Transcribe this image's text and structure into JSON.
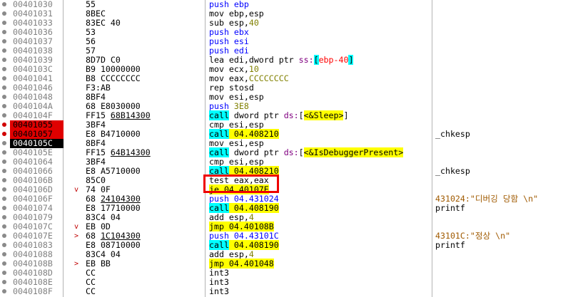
{
  "rows": [
    {
      "addr": "00401030",
      "hex": "55",
      "instr": [
        {
          "t": "push",
          "c": "k-blue"
        },
        {
          "t": " ebp",
          "c": "k-blue"
        }
      ]
    },
    {
      "addr": "00401031",
      "hex": "8BEC",
      "instr": [
        {
          "t": "mov ebp,esp",
          "c": ""
        }
      ]
    },
    {
      "addr": "00401033",
      "hex": "83EC 40",
      "instr": [
        {
          "t": "sub esp,",
          "c": ""
        },
        {
          "t": "40",
          "c": "k-green"
        }
      ]
    },
    {
      "addr": "00401036",
      "hex": "53",
      "instr": [
        {
          "t": "push ebx",
          "c": "k-blue"
        }
      ]
    },
    {
      "addr": "00401037",
      "hex": "56",
      "instr": [
        {
          "t": "push esi",
          "c": "k-blue"
        }
      ]
    },
    {
      "addr": "00401038",
      "hex": "57",
      "instr": [
        {
          "t": "push edi",
          "c": "k-blue"
        }
      ]
    },
    {
      "addr": "00401039",
      "hex": "8D7D C0",
      "instr": [
        {
          "t": "lea edi,dword ptr ",
          "c": ""
        },
        {
          "t": "ss:",
          "c": "k-mag"
        },
        {
          "t": "[",
          "c": "k-bracket"
        },
        {
          "t": "ebp-40",
          "c": "k-red"
        },
        {
          "t": "]",
          "c": "k-bracket"
        }
      ]
    },
    {
      "addr": "0040103C",
      "hex": "B9 10000000",
      "instr": [
        {
          "t": "mov ecx,",
          "c": ""
        },
        {
          "t": "10",
          "c": "k-green"
        }
      ]
    },
    {
      "addr": "00401041",
      "hex": "B8 CCCCCCCC",
      "instr": [
        {
          "t": "mov eax,",
          "c": ""
        },
        {
          "t": "CCCCCCCC",
          "c": "k-green"
        }
      ]
    },
    {
      "addr": "00401046",
      "hex": "F3:AB",
      "instr": [
        {
          "t": "rep stosd",
          "c": ""
        }
      ]
    },
    {
      "addr": "00401048",
      "hex": "8BF4",
      "instr": [
        {
          "t": "mov esi,esp",
          "c": ""
        }
      ]
    },
    {
      "addr": "0040104A",
      "hex": "68 E8030000",
      "instr": [
        {
          "t": "push ",
          "c": "k-blue"
        },
        {
          "t": "3E8",
          "c": "k-green"
        }
      ]
    },
    {
      "addr": "0040104F",
      "hex": "FF15 ",
      "hexul": "68B14300",
      "instr": [
        {
          "t": "call",
          "c": "hl-call"
        },
        {
          "t": " dword ptr ",
          "c": ""
        },
        {
          "t": "ds:",
          "c": "k-mag"
        },
        {
          "t": "[",
          "c": ""
        },
        {
          "t": "<&Sleep>",
          "c": "hl-api"
        },
        {
          "t": "]",
          "c": ""
        }
      ]
    },
    {
      "addr": "00401055",
      "hex": "3BF4",
      "mark": "bp",
      "dot": "red",
      "instr": [
        {
          "t": "cmp esi,esp",
          "c": ""
        }
      ]
    },
    {
      "addr": "00401057",
      "hex": "E8 B4710000",
      "mark": "bp",
      "dot": "red",
      "instr": [
        {
          "t": "call",
          "c": "hl-call"
        },
        {
          "t": " 04.408210",
          "c": "hl-dest"
        }
      ],
      "cmt": "_chkesp"
    },
    {
      "addr": "0040105C",
      "hex": "8BF4",
      "mark": "eip",
      "instr": [
        {
          "t": "mov esi,esp",
          "c": ""
        }
      ]
    },
    {
      "addr": "0040105E",
      "hex": "FF15 ",
      "hexul": "64B14300",
      "instr": [
        {
          "t": "call",
          "c": "hl-call"
        },
        {
          "t": " dword ptr ",
          "c": ""
        },
        {
          "t": "ds:",
          "c": "k-mag"
        },
        {
          "t": "[",
          "c": ""
        },
        {
          "t": "<&IsDebuggerPresent>",
          "c": "hl-api"
        }
      ]
    },
    {
      "addr": "00401064",
      "hex": "3BF4",
      "instr": [
        {
          "t": "cmp esi,esp",
          "c": ""
        }
      ]
    },
    {
      "addr": "00401066",
      "hex": "E8 A5710000",
      "instr": [
        {
          "t": "call",
          "c": "hl-call"
        },
        {
          "t": " 04.408210",
          "c": "hl-dest"
        }
      ],
      "cmt": "_chkesp"
    },
    {
      "addr": "0040106B",
      "hex": "85C0",
      "instr": [
        {
          "t": "test eax,eax",
          "c": ""
        }
      ]
    },
    {
      "addr": "0040106D",
      "hex": "74 0F",
      "arrow": "v",
      "instr": [
        {
          "t": "je",
          "c": "hl-jmp"
        },
        {
          "t": " 04.40107E",
          "c": "hl-dest"
        }
      ]
    },
    {
      "addr": "0040106F",
      "hex": "68 ",
      "hexul": "24104300",
      "instr": [
        {
          "t": "push",
          "c": "k-blue"
        },
        {
          "t": " 04.431024",
          "c": "k-blue"
        }
      ],
      "cmt": "431024:\"디버깅 당함 \\n\"",
      "cmtc": "str"
    },
    {
      "addr": "00401074",
      "hex": "E8 17710000",
      "instr": [
        {
          "t": "call",
          "c": "hl-call"
        },
        {
          "t": " 04.408190",
          "c": "hl-dest"
        }
      ],
      "cmt": "printf"
    },
    {
      "addr": "00401079",
      "hex": "83C4 04",
      "instr": [
        {
          "t": "add esp,",
          "c": ""
        },
        {
          "t": "4",
          "c": "k-green"
        }
      ]
    },
    {
      "addr": "0040107C",
      "hex": "EB 0D",
      "arrow": "v",
      "instr": [
        {
          "t": "jmp",
          "c": "hl-jmp"
        },
        {
          "t": " 04.40108B",
          "c": "hl-dest"
        }
      ]
    },
    {
      "addr": "0040107E",
      "hex": "68 ",
      "hexul": "1C104300",
      "arrow": ">",
      "instr": [
        {
          "t": "push",
          "c": "k-blue"
        },
        {
          "t": " 04.43101C",
          "c": "k-blue"
        }
      ],
      "cmt": "43101C:\"정상 \\n\"",
      "cmtc": "str"
    },
    {
      "addr": "00401083",
      "hex": "E8 08710000",
      "instr": [
        {
          "t": "call",
          "c": "hl-call"
        },
        {
          "t": " 04.408190",
          "c": "hl-dest"
        }
      ],
      "cmt": "printf"
    },
    {
      "addr": "00401088",
      "hex": "83C4 04",
      "instr": [
        {
          "t": "add esp,",
          "c": ""
        },
        {
          "t": "4",
          "c": "k-green"
        }
      ]
    },
    {
      "addr": "0040108B",
      "hex": "EB BB",
      "arrow": ">",
      "instr": [
        {
          "t": "jmp",
          "c": "hl-jmp"
        },
        {
          "t": " 04.401048",
          "c": "hl-dest"
        }
      ]
    },
    {
      "addr": "0040108D",
      "hex": "CC",
      "instr": [
        {
          "t": "int3",
          "c": ""
        }
      ]
    },
    {
      "addr": "0040108E",
      "hex": "CC",
      "instr": [
        {
          "t": "int3",
          "c": ""
        }
      ]
    },
    {
      "addr": "0040108F",
      "hex": "CC",
      "instr": [
        {
          "t": "int3",
          "c": ""
        }
      ]
    }
  ]
}
